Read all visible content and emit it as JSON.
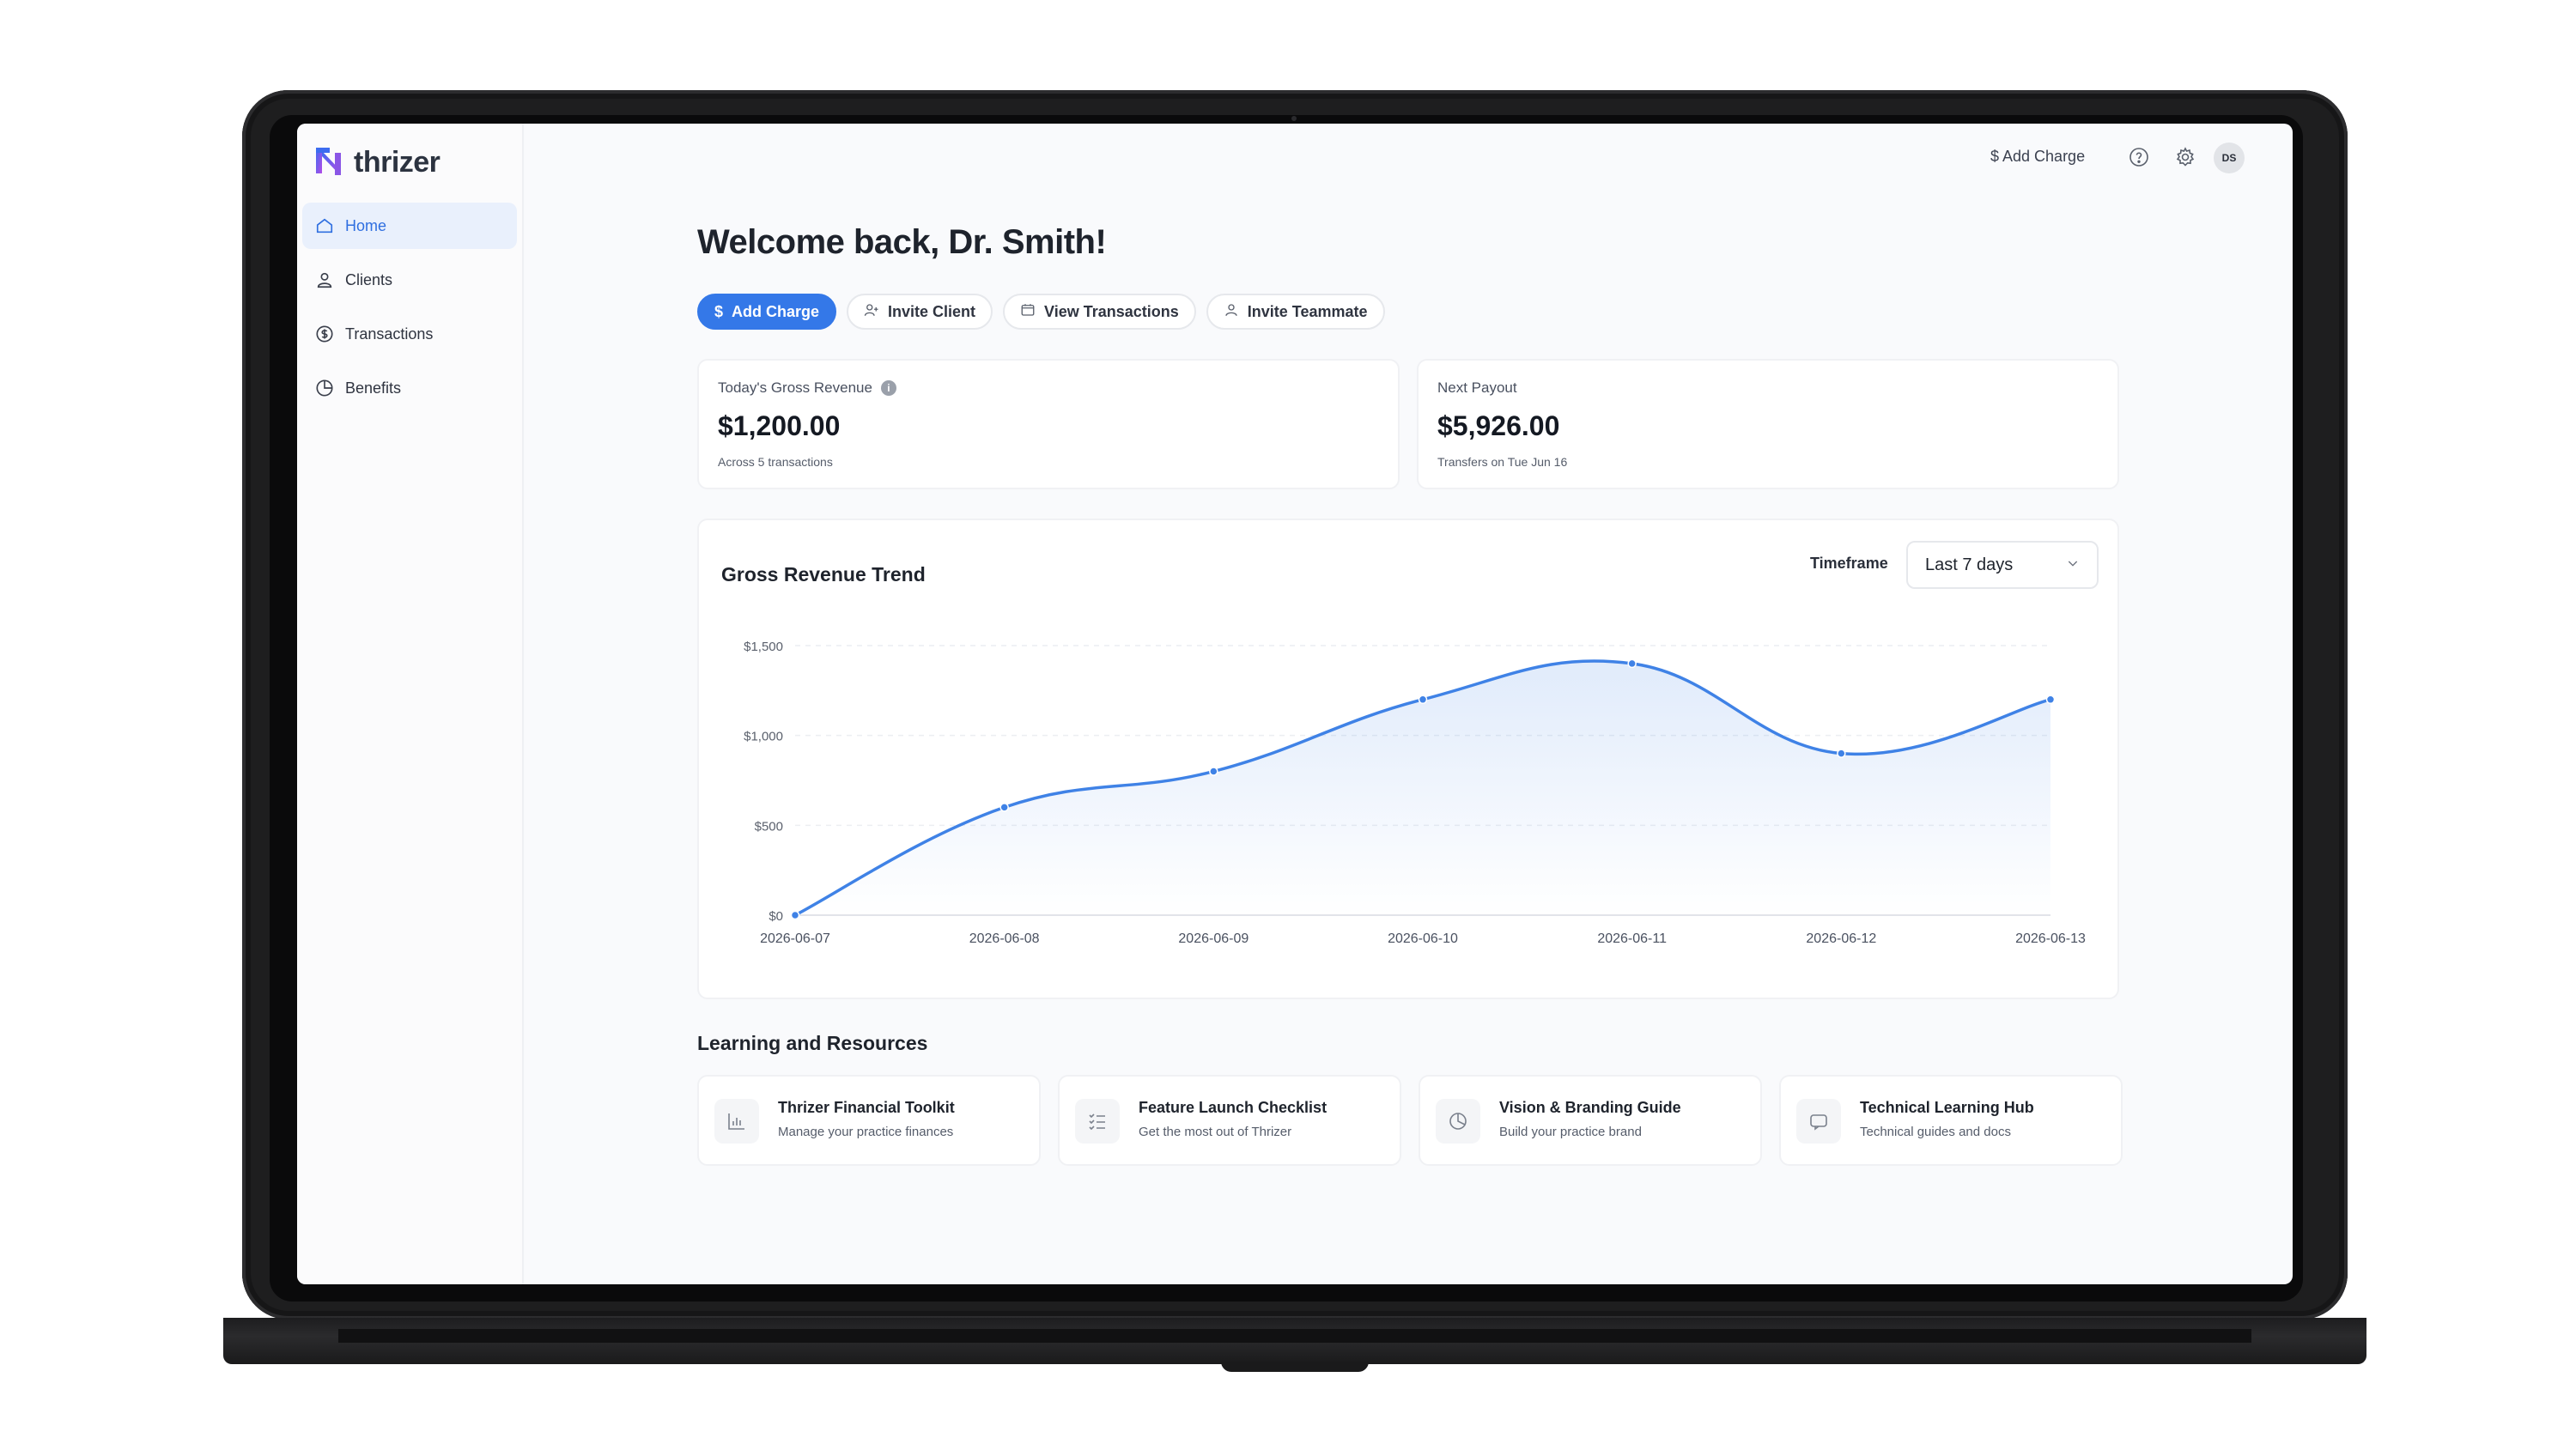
{
  "brand": {
    "name": "thrizer"
  },
  "sidebar": {
    "items": [
      {
        "label": "Home",
        "icon": "home-icon",
        "active": true
      },
      {
        "label": "Clients",
        "icon": "user-icon",
        "active": false
      },
      {
        "label": "Transactions",
        "icon": "dollar-circle-icon",
        "active": false
      },
      {
        "label": "Benefits",
        "icon": "pie-chart-icon",
        "active": false
      }
    ]
  },
  "topbar": {
    "add_charge": "$ Add Charge",
    "avatar_initials": "DS"
  },
  "main": {
    "welcome": "Welcome back, Dr. Smith!",
    "actions": [
      {
        "label": "Add Charge",
        "glyph": "$"
      },
      {
        "label": "Invite Client"
      },
      {
        "label": "View Transactions"
      },
      {
        "label": "Invite Teammate"
      }
    ],
    "kpis": [
      {
        "label": "Today's Gross Revenue",
        "value": "$1,200.00",
        "sub": "Across 5 transactions",
        "info_glyph": "i"
      },
      {
        "label": "Next Payout",
        "value": "$5,926.00",
        "sub": "Transfers on Tue Jun 16"
      }
    ],
    "timeframe": {
      "label": "Timeframe",
      "selected": "Last 7 days"
    },
    "resources": {
      "heading": "Learning and Resources",
      "items": [
        {
          "title": "Thrizer Financial Toolkit",
          "subtitle": "Manage your practice finances",
          "icon": "bar-chart-icon"
        },
        {
          "title": "Feature Launch Checklist",
          "subtitle": "Get the most out of Thrizer",
          "icon": "checklist-icon"
        },
        {
          "title": "Vision & Branding Guide",
          "subtitle": "Build your practice brand",
          "icon": "pie-chart-icon"
        },
        {
          "title": "Technical Learning Hub",
          "subtitle": "Technical guides and docs",
          "icon": "chat-icon"
        }
      ]
    }
  },
  "colors": {
    "accent": "#3478e8",
    "line": "#3f82e6",
    "sidebar_active_bg": "#e9f0fc"
  },
  "chart_data": {
    "type": "area",
    "title": "Gross Revenue Trend",
    "x": [
      "2026-06-07",
      "2026-06-08",
      "2026-06-09",
      "2026-06-10",
      "2026-06-11",
      "2026-06-12",
      "2026-06-13"
    ],
    "series": [
      {
        "values": [
          0,
          600,
          800,
          1200,
          1400,
          900,
          1200
        ]
      }
    ],
    "ylim": [
      0,
      1500
    ],
    "yticks": [
      0,
      500,
      1000,
      1500
    ],
    "ytick_labels": [
      "$0",
      "$500",
      "$1,000",
      "$1,500"
    ],
    "grid": true
  }
}
